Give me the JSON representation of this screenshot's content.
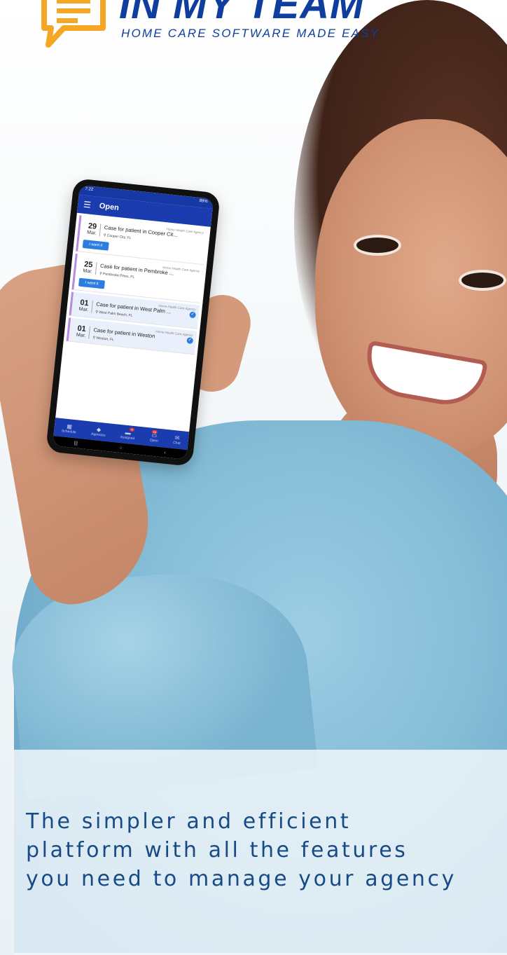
{
  "brand": {
    "name": "IN MY TEAM",
    "tagline": "HOME CARE SOFTWARE MADE EASY",
    "colors": {
      "primary": "#103e9e",
      "accent": "#f5a623"
    }
  },
  "phone": {
    "status_time": "7:22",
    "status_battery": "89%",
    "app_title": "Open",
    "cases": [
      {
        "agency": "Home Health Care Agency",
        "day": "29",
        "month": "Mar.",
        "title": "Case for patient in Cooper Cit...",
        "location": "Cooper City, FL",
        "action": "I want it"
      },
      {
        "agency": "Home Health Care Agency",
        "day": "25",
        "month": "Mar.",
        "title": "Case for patient in Pembroke ...",
        "location": "Pembroke Pines, FL",
        "action": "I want it"
      },
      {
        "agency": "Home Health Care Agency",
        "day": "01",
        "month": "Mar.",
        "title": "Case for patient in West Palm ...",
        "location": "West Palm Beach, FL"
      },
      {
        "agency": "Home Health Care Agency",
        "day": "01",
        "month": "Mar.",
        "title": "Case for patient in Weston",
        "location": "Weston, FL"
      }
    ],
    "tabs": [
      {
        "label": "Schedule",
        "icon": "calendar-icon"
      },
      {
        "label": "Agencies",
        "icon": "tag-icon"
      },
      {
        "label": "Assigned",
        "icon": "folder-icon",
        "badge": "4"
      },
      {
        "label": "Open",
        "icon": "inbox-icon",
        "badge": "10"
      },
      {
        "label": "Chat",
        "icon": "mail-icon"
      }
    ]
  },
  "hero": {
    "line1": "The simpler and efficient",
    "line2": "platform with all the features",
    "line3": "you need to manage your agency"
  }
}
